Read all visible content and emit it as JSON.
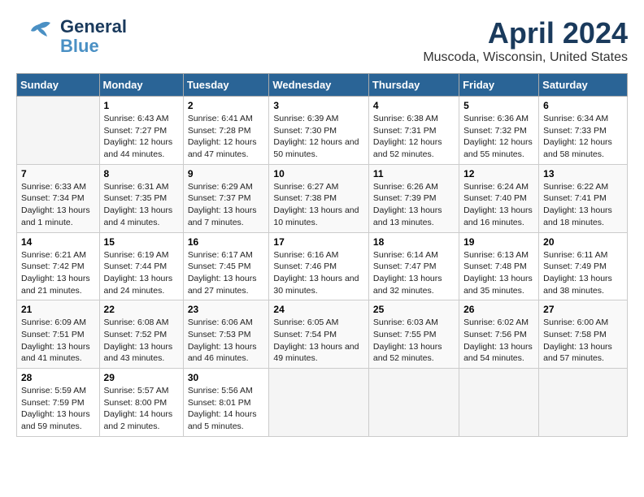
{
  "header": {
    "logo_general": "General",
    "logo_blue": "Blue",
    "month": "April 2024",
    "location": "Muscoda, Wisconsin, United States"
  },
  "weekdays": [
    "Sunday",
    "Monday",
    "Tuesday",
    "Wednesday",
    "Thursday",
    "Friday",
    "Saturday"
  ],
  "weeks": [
    [
      {
        "day": "",
        "content": ""
      },
      {
        "day": "1",
        "content": "Sunrise: 6:43 AM\nSunset: 7:27 PM\nDaylight: 12 hours\nand 44 minutes."
      },
      {
        "day": "2",
        "content": "Sunrise: 6:41 AM\nSunset: 7:28 PM\nDaylight: 12 hours\nand 47 minutes."
      },
      {
        "day": "3",
        "content": "Sunrise: 6:39 AM\nSunset: 7:30 PM\nDaylight: 12 hours\nand 50 minutes."
      },
      {
        "day": "4",
        "content": "Sunrise: 6:38 AM\nSunset: 7:31 PM\nDaylight: 12 hours\nand 52 minutes."
      },
      {
        "day": "5",
        "content": "Sunrise: 6:36 AM\nSunset: 7:32 PM\nDaylight: 12 hours\nand 55 minutes."
      },
      {
        "day": "6",
        "content": "Sunrise: 6:34 AM\nSunset: 7:33 PM\nDaylight: 12 hours\nand 58 minutes."
      }
    ],
    [
      {
        "day": "7",
        "content": "Sunrise: 6:33 AM\nSunset: 7:34 PM\nDaylight: 13 hours\nand 1 minute."
      },
      {
        "day": "8",
        "content": "Sunrise: 6:31 AM\nSunset: 7:35 PM\nDaylight: 13 hours\nand 4 minutes."
      },
      {
        "day": "9",
        "content": "Sunrise: 6:29 AM\nSunset: 7:37 PM\nDaylight: 13 hours\nand 7 minutes."
      },
      {
        "day": "10",
        "content": "Sunrise: 6:27 AM\nSunset: 7:38 PM\nDaylight: 13 hours\nand 10 minutes."
      },
      {
        "day": "11",
        "content": "Sunrise: 6:26 AM\nSunset: 7:39 PM\nDaylight: 13 hours\nand 13 minutes."
      },
      {
        "day": "12",
        "content": "Sunrise: 6:24 AM\nSunset: 7:40 PM\nDaylight: 13 hours\nand 16 minutes."
      },
      {
        "day": "13",
        "content": "Sunrise: 6:22 AM\nSunset: 7:41 PM\nDaylight: 13 hours\nand 18 minutes."
      }
    ],
    [
      {
        "day": "14",
        "content": "Sunrise: 6:21 AM\nSunset: 7:42 PM\nDaylight: 13 hours\nand 21 minutes."
      },
      {
        "day": "15",
        "content": "Sunrise: 6:19 AM\nSunset: 7:44 PM\nDaylight: 13 hours\nand 24 minutes."
      },
      {
        "day": "16",
        "content": "Sunrise: 6:17 AM\nSunset: 7:45 PM\nDaylight: 13 hours\nand 27 minutes."
      },
      {
        "day": "17",
        "content": "Sunrise: 6:16 AM\nSunset: 7:46 PM\nDaylight: 13 hours\nand 30 minutes."
      },
      {
        "day": "18",
        "content": "Sunrise: 6:14 AM\nSunset: 7:47 PM\nDaylight: 13 hours\nand 32 minutes."
      },
      {
        "day": "19",
        "content": "Sunrise: 6:13 AM\nSunset: 7:48 PM\nDaylight: 13 hours\nand 35 minutes."
      },
      {
        "day": "20",
        "content": "Sunrise: 6:11 AM\nSunset: 7:49 PM\nDaylight: 13 hours\nand 38 minutes."
      }
    ],
    [
      {
        "day": "21",
        "content": "Sunrise: 6:09 AM\nSunset: 7:51 PM\nDaylight: 13 hours\nand 41 minutes."
      },
      {
        "day": "22",
        "content": "Sunrise: 6:08 AM\nSunset: 7:52 PM\nDaylight: 13 hours\nand 43 minutes."
      },
      {
        "day": "23",
        "content": "Sunrise: 6:06 AM\nSunset: 7:53 PM\nDaylight: 13 hours\nand 46 minutes."
      },
      {
        "day": "24",
        "content": "Sunrise: 6:05 AM\nSunset: 7:54 PM\nDaylight: 13 hours\nand 49 minutes."
      },
      {
        "day": "25",
        "content": "Sunrise: 6:03 AM\nSunset: 7:55 PM\nDaylight: 13 hours\nand 52 minutes."
      },
      {
        "day": "26",
        "content": "Sunrise: 6:02 AM\nSunset: 7:56 PM\nDaylight: 13 hours\nand 54 minutes."
      },
      {
        "day": "27",
        "content": "Sunrise: 6:00 AM\nSunset: 7:58 PM\nDaylight: 13 hours\nand 57 minutes."
      }
    ],
    [
      {
        "day": "28",
        "content": "Sunrise: 5:59 AM\nSunset: 7:59 PM\nDaylight: 13 hours\nand 59 minutes."
      },
      {
        "day": "29",
        "content": "Sunrise: 5:57 AM\nSunset: 8:00 PM\nDaylight: 14 hours\nand 2 minutes."
      },
      {
        "day": "30",
        "content": "Sunrise: 5:56 AM\nSunset: 8:01 PM\nDaylight: 14 hours\nand 5 minutes."
      },
      {
        "day": "",
        "content": ""
      },
      {
        "day": "",
        "content": ""
      },
      {
        "day": "",
        "content": ""
      },
      {
        "day": "",
        "content": ""
      }
    ]
  ]
}
